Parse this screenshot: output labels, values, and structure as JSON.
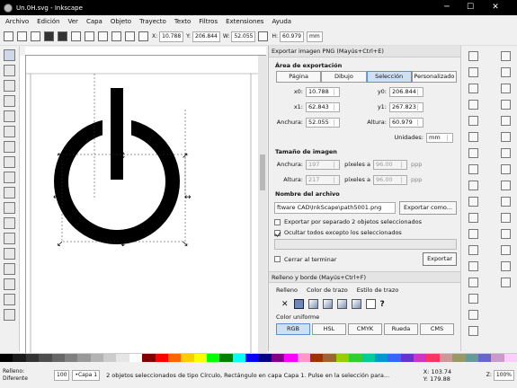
{
  "window": {
    "title": "Un.0H.svg - Inkscape",
    "controls": {
      "minimize": "─",
      "maximize": "☐",
      "close": "✕"
    }
  },
  "menu": [
    "Archivo",
    "Edición",
    "Ver",
    "Capa",
    "Objeto",
    "Trayecto",
    "Texto",
    "Filtros",
    "Extensiones",
    "Ayuda"
  ],
  "command_bar": {
    "x_label": "X:",
    "x_value": "10.788",
    "y_label": "Y:",
    "y_value": "206.844",
    "w_label": "W:",
    "w_value": "52.055",
    "h_label": "H:",
    "h_value": "60.979",
    "unit": "mm"
  },
  "export_panel": {
    "title": "Exportar imagen PNG (Mayús+Ctrl+E)",
    "area_heading": "Área de exportación",
    "area_buttons": [
      "Página",
      "Dibujo",
      "Selección",
      "Personalizado"
    ],
    "area_selected_index": 2,
    "x0_label": "x0:",
    "x0_value": "10.788",
    "y0_label": "y0:",
    "y0_value": "206.844",
    "x1_label": "x1:",
    "x1_value": "62.843",
    "y1_label": "y1:",
    "y1_value": "267.823",
    "width_label": "Anchura:",
    "width_value": "52.055",
    "height_label": "Altura:",
    "height_value": "60.979",
    "units_label": "Unidades:",
    "units_value": "mm",
    "size_heading": "Tamaño de imagen",
    "img_width_label": "Anchura:",
    "img_width_value": "197",
    "img_height_label": "Altura:",
    "img_height_value": "217",
    "dpi_label": "píxeles a",
    "dpi_value": "96.00",
    "dpi_unit": "ppp",
    "dpi2_value": "96.00",
    "filename_heading": "Nombre del archivo",
    "filename_value": "ftware CAD\\InkScape\\path5001.png",
    "export_as_label": "Exportar como...",
    "batch_label": "Exportar por separado 2 objetos seleccionados",
    "batch_checked": false,
    "hide_label": "Ocultar todos excepto los seleccionados",
    "hide_checked": true,
    "close_label": "Cerrar al terminar",
    "close_checked": false,
    "export_label": "Exportar"
  },
  "fill_panel": {
    "title": "Relleno y borde (Mayús+Ctrl+F)",
    "tabs": [
      "Relleno",
      "Color de trazo",
      "Estilo de trazo"
    ],
    "flat_color_label": "Color uniforme",
    "color_modes": [
      "RGB",
      "HSL",
      "CMYK",
      "Rueda",
      "CMS"
    ]
  },
  "status": {
    "fill_label": "Relleno:",
    "stroke_label": "Diferente",
    "opacity_value": "100",
    "layer": "•Capa 1",
    "message": "2 objetos seleccionados de tipo Círculo, Rectángulo en capa Capa 1. Pulse en la selección para...",
    "x_label": "X:",
    "x_value": "103.74",
    "y_label": "Y:",
    "y_value": "179.88",
    "zoom_label": "Z:",
    "zoom_value": "100%"
  },
  "palette_colors": [
    "#000000",
    "#1a1a1a",
    "#333333",
    "#4d4d4d",
    "#666666",
    "#808080",
    "#999999",
    "#b3b3b3",
    "#cccccc",
    "#e6e6e6",
    "#ffffff",
    "#800000",
    "#ff0000",
    "#ff6600",
    "#ffcc00",
    "#ffff00",
    "#00ff00",
    "#008000",
    "#00ffff",
    "#0000ff",
    "#000080",
    "#800080",
    "#ff00ff",
    "#ff99cc",
    "#993300",
    "#996633",
    "#99cc00",
    "#33cc33",
    "#00cc99",
    "#0099cc",
    "#3366ff",
    "#6633cc",
    "#cc33cc",
    "#ff3366",
    "#cc9999",
    "#999966",
    "#669999",
    "#6666cc",
    "#cc99cc",
    "#ffccff"
  ]
}
